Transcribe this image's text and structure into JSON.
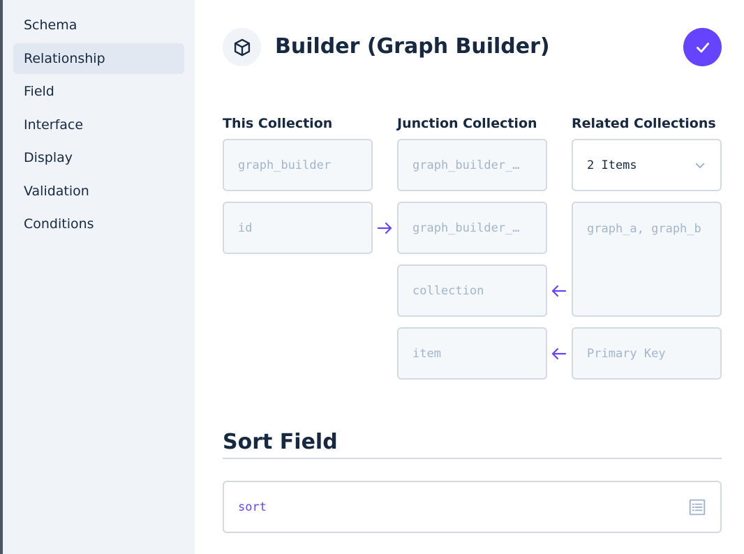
{
  "sidebar": {
    "items": [
      {
        "label": "Schema",
        "active": false
      },
      {
        "label": "Relationship",
        "active": true
      },
      {
        "label": "Field",
        "active": false
      },
      {
        "label": "Interface",
        "active": false
      },
      {
        "label": "Display",
        "active": false
      },
      {
        "label": "Validation",
        "active": false
      },
      {
        "label": "Conditions",
        "active": false
      }
    ]
  },
  "header": {
    "icon": "box-icon",
    "title": "Builder (Graph Builder)",
    "save_icon": "check-icon"
  },
  "relationship": {
    "this_collection": {
      "label": "This Collection",
      "collection": "graph_builder",
      "field": "id"
    },
    "junction_collection": {
      "label": "Junction Collection",
      "collection": "graph_builder_…",
      "field": "graph_builder_…",
      "collection_field": "collection",
      "item_field": "item"
    },
    "related_collections": {
      "label": "Related Collections",
      "selected": "2 Items",
      "collections": "graph_a, graph_b",
      "primary_key": "Primary Key"
    }
  },
  "sort": {
    "title": "Sort Field",
    "value": "sort",
    "icon": "list-icon"
  },
  "colors": {
    "accent": "#6644ff",
    "text": "#172940",
    "muted_text": "#a2b5cd",
    "border": "#d3dae4",
    "sidebar_bg": "#f0f4f9",
    "active_bg": "#e1e8f1"
  }
}
